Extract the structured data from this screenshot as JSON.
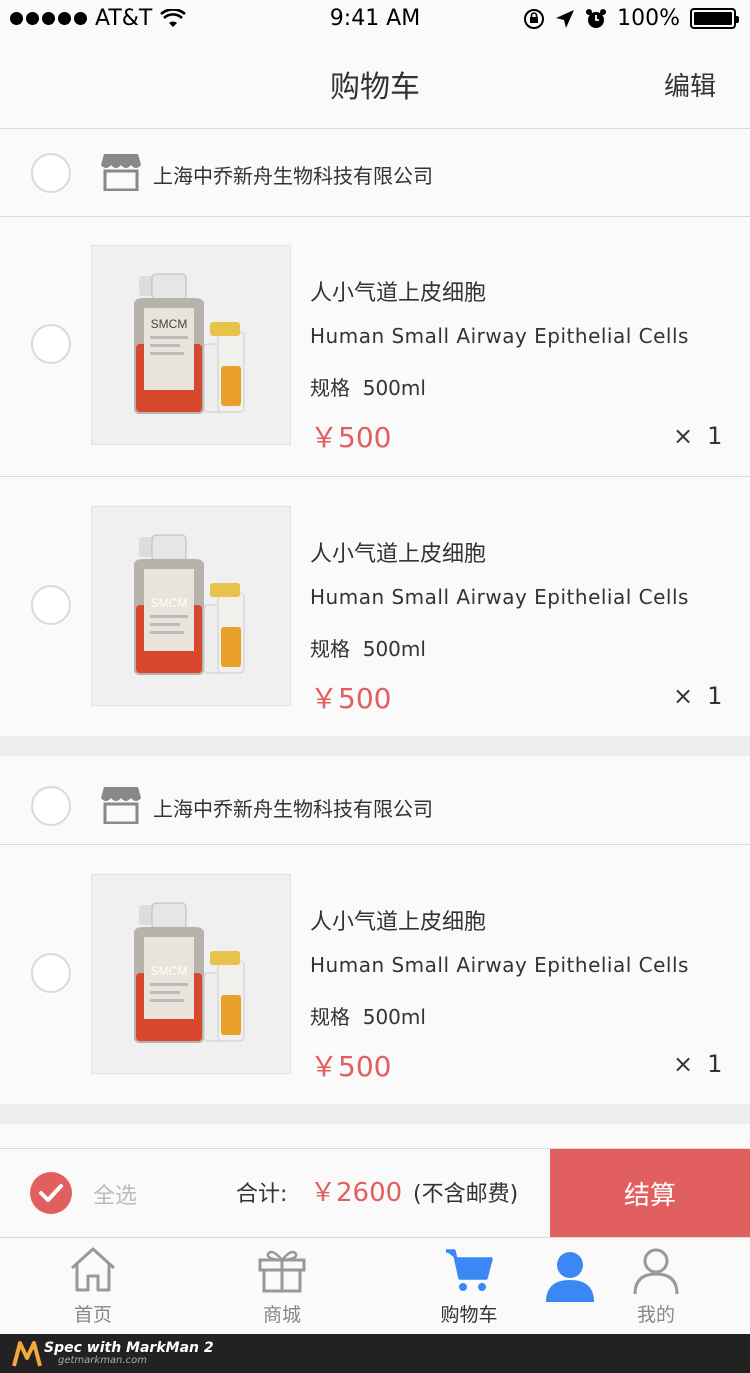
{
  "status_bar": {
    "carrier": "AT&T",
    "time": "9:41 AM",
    "battery": "100%"
  },
  "nav": {
    "title": "购物车",
    "edit": "编辑"
  },
  "shops": [
    {
      "name": "上海中乔新舟生物科技有限公司",
      "items": [
        {
          "name": "人小气道上皮细胞",
          "en": "Human Small Airway Epithelial Cells",
          "spec_label": "规格",
          "spec_value": "500ml",
          "price": "￥500",
          "qty_symbol": "×",
          "qty": "1",
          "bottle_label": "SMCM"
        },
        {
          "name": "人小气道上皮细胞",
          "en": "Human Small Airway Epithelial Cells",
          "spec_label": "规格",
          "spec_value": "500ml",
          "price": "￥500",
          "qty_symbol": "×",
          "qty": "1",
          "bottle_label": "SMCM"
        }
      ]
    },
    {
      "name": "上海中乔新舟生物科技有限公司",
      "items": [
        {
          "name": "人小气道上皮细胞",
          "en": "Human Small Airway Epithelial Cells",
          "spec_label": "规格",
          "spec_value": "500ml",
          "price": "￥500",
          "qty_symbol": "×",
          "qty": "1",
          "bottle_label": "SMCM"
        }
      ]
    }
  ],
  "bottom": {
    "select_all": "全选",
    "total_label": "合计:",
    "total_value": "￥2600",
    "total_note": "(不含邮费)",
    "checkout": "结算"
  },
  "tabs": [
    {
      "label": "首页",
      "icon": "home-icon"
    },
    {
      "label": "商城",
      "icon": "gift-icon"
    },
    {
      "label": "购物车",
      "icon": "cart-icon"
    },
    {
      "label": "我的",
      "icon": "user-icon"
    }
  ],
  "footer": {
    "brand": "Spec with MarkMan 2",
    "url": "getmarkman.com"
  },
  "colors": {
    "accent": "#e25f5f",
    "text": "#333333",
    "divider": "#d9d9d9",
    "gap": "#eeeeee",
    "background": "#fafafa",
    "tab_active": "#3b87f3"
  }
}
